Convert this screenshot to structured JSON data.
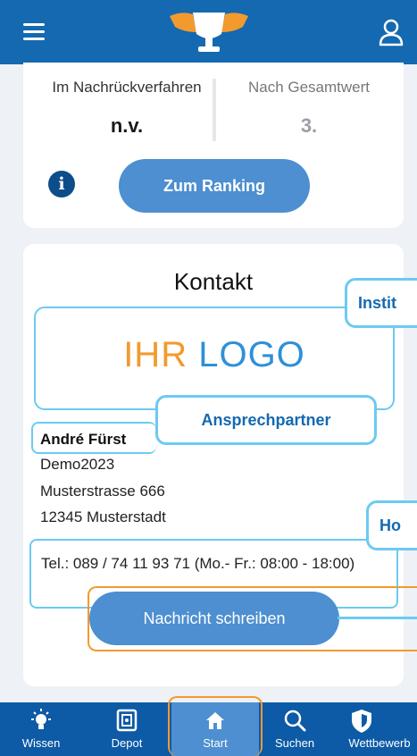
{
  "header": {
    "menu_icon": "hamburger-menu-icon",
    "logo_icon": "trophy-logo-icon",
    "user_icon": "user-icon",
    "color": "#1469b0"
  },
  "ranking": {
    "left_label": "Im Nachrückverfahren",
    "left_value": "n.v.",
    "right_label": "Nach Gesamtwert",
    "right_value": "3.",
    "info_icon": "info-icon",
    "button_label": "Zum Ranking"
  },
  "contact": {
    "title": "Kontakt",
    "logo_part1": "IHR",
    "logo_part2": "LOGO",
    "name": "André Fürst",
    "company": "Demo2023",
    "street": "Musterstrasse 666",
    "city": "12345 Musterstadt",
    "phone": "Tel.: 089 / 74 11 93 71 (Mo.- Fr.: 08:00 - 18:00)",
    "message_button": "Nachricht schreiben"
  },
  "callouts": {
    "institut": "Instit",
    "ansprechpartner": "Ansprechpartner",
    "homepage": "Ho"
  },
  "nav": [
    {
      "label": "Wissen",
      "icon": "lightbulb-icon"
    },
    {
      "label": "Depot",
      "icon": "safe-icon"
    },
    {
      "label": "Start",
      "icon": "home-icon"
    },
    {
      "label": "Suchen",
      "icon": "search-icon"
    },
    {
      "label": "Wettbewerb",
      "icon": "shield-icon"
    }
  ],
  "colors": {
    "primary": "#1469b0",
    "button": "#4d8fd0",
    "highlight_blue": "#6ccaf2",
    "highlight_orange": "#f29a2e"
  }
}
